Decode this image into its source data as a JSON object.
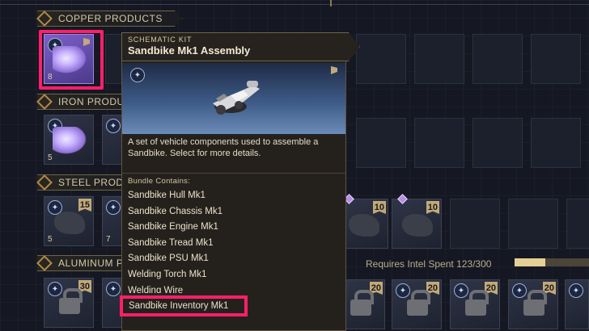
{
  "categories": [
    {
      "name": "COPPER PRODUCTS"
    },
    {
      "name": "IRON PRODUCTS"
    },
    {
      "name": "STEEL PRODUCTS"
    },
    {
      "name": "ALUMINUM PRODUCTS"
    }
  ],
  "copper_slot": {
    "count": "8"
  },
  "iron_slot": {
    "count": "5"
  },
  "steel_slots": [
    {
      "count": "5",
      "tag": "15"
    },
    {
      "count": "7",
      "tag": ""
    }
  ],
  "steel_right_tags": [
    "10",
    "10"
  ],
  "aluminum_tags": [
    "30",
    "20",
    "20",
    "20",
    "20",
    "20"
  ],
  "intel": {
    "label": "Requires Intel Spent 123/300",
    "spent": 123,
    "required": 300
  },
  "tooltip": {
    "kind": "SCHEMATIC KIT",
    "title": "Sandbike Mk1 Assembly",
    "description": "A set of vehicle components used to assemble a Sandbike.  Select for more details.",
    "bundle_label": "Bundle Contains:",
    "items": [
      "Sandbike Hull Mk1",
      "Sandbike Chassis Mk1",
      "Sandbike Engine Mk1",
      "Sandbike Tread Mk1",
      "Sandbike PSU Mk1",
      "Welding Torch Mk1",
      "Welding Wire"
    ],
    "highlighted_item": "Sandbike Inventory Mk1"
  },
  "colors": {
    "highlight": "#ff1f6b",
    "accent_gold": "#c2a979",
    "selected_purple": "#7d5fc8"
  }
}
